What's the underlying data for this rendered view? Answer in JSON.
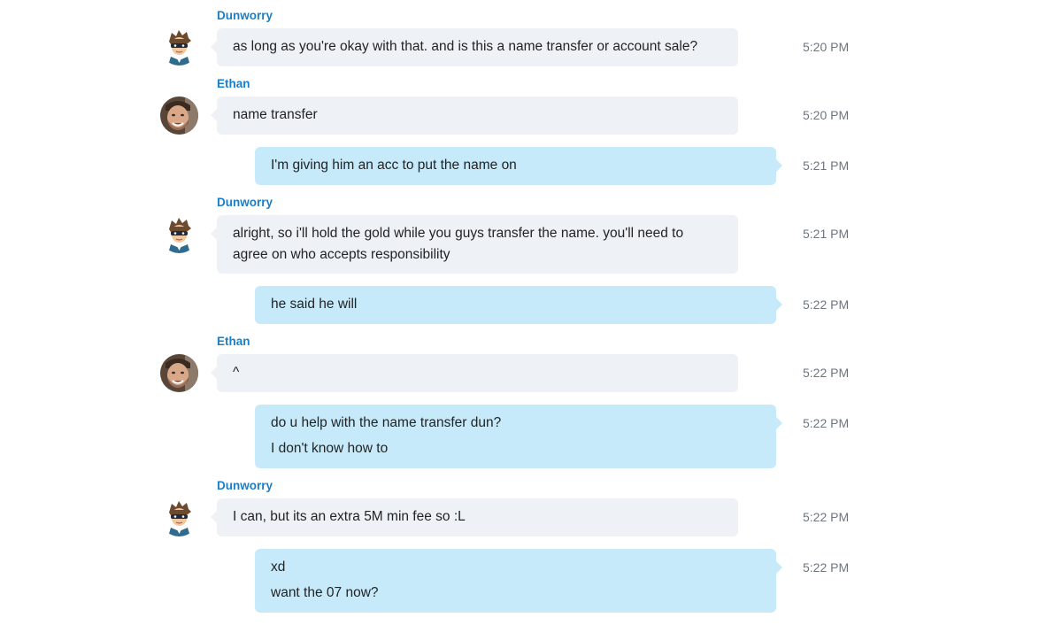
{
  "participants": {
    "dunworry": "Dunworry",
    "ethan": "Ethan"
  },
  "messages": [
    {
      "sender": "Dunworry",
      "lines": [
        "as long as you're okay with that. and is this a name transfer or account sale?"
      ],
      "time": "5:20 PM"
    },
    {
      "sender": "Ethan",
      "lines": [
        "name transfer"
      ],
      "time": "5:20 PM"
    },
    {
      "sender": "me",
      "lines": [
        "I'm giving him an acc to put the name on"
      ],
      "time": "5:21 PM"
    },
    {
      "sender": "Dunworry",
      "lines": [
        "alright, so i'll hold the gold while you guys transfer the name. you'll need to",
        "agree on who accepts responsibility"
      ],
      "time": "5:21 PM"
    },
    {
      "sender": "me",
      "lines": [
        "he said he will"
      ],
      "time": "5:22 PM"
    },
    {
      "sender": "Ethan",
      "lines": [
        "^"
      ],
      "time": "5:22 PM"
    },
    {
      "sender": "me",
      "lines": [
        "do u help with the name transfer dun?",
        "I don't know how to"
      ],
      "time": "5:22 PM"
    },
    {
      "sender": "Dunworry",
      "lines": [
        "I can, but its an extra 5M min fee so :L"
      ],
      "time": "5:22 PM"
    },
    {
      "sender": "me",
      "lines": [
        "xd",
        "want the 07 now?"
      ],
      "time": "5:22 PM"
    }
  ],
  "colors": {
    "sender_name": "#1a7fc8",
    "incoming_bubble": "#eef1f5",
    "outgoing_bubble": "#c6eaf9",
    "timestamp": "#6d7680"
  },
  "icons": {
    "dunworry_avatar": "masked-cartoon-avatar-icon",
    "ethan_avatar": "profile-photo-avatar-icon"
  }
}
